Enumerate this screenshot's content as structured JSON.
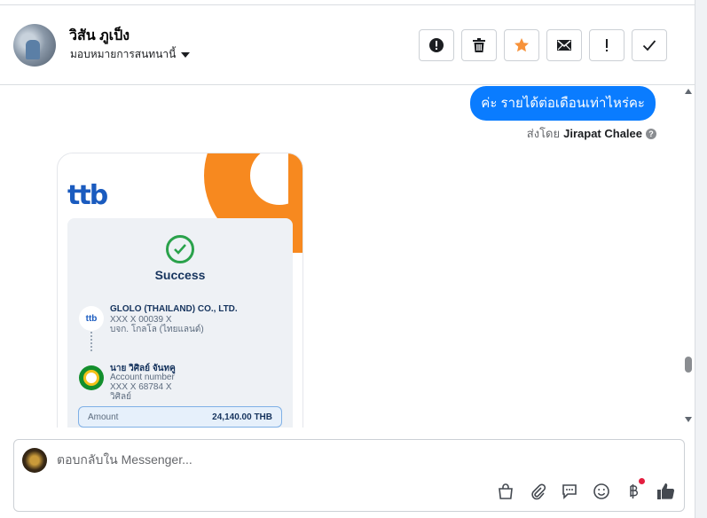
{
  "header": {
    "contact_name": "วิสัน ภูเป็ง",
    "assign_label": "มอบหมายการสนทนานี้"
  },
  "actions": [
    {
      "name": "report-spam",
      "icon": "alert-circle-icon"
    },
    {
      "name": "delete",
      "icon": "trash-icon"
    },
    {
      "name": "star",
      "icon": "star-icon",
      "color": "#f7923a"
    },
    {
      "name": "mark-unread",
      "icon": "envelope-icon"
    },
    {
      "name": "follow-up",
      "icon": "exclamation-icon"
    },
    {
      "name": "mark-done",
      "icon": "checkmark-icon"
    }
  ],
  "messages": {
    "outgoing_text": "ค่ะ รายได้ต่อเดือนเท่าไหร่คะ",
    "sent_by_prefix": "ส่งโดย",
    "sent_by_name": "Jirapat Chalee",
    "bubble_color": "#0a7cff"
  },
  "slip": {
    "logo_part1": "tt",
    "logo_part2": "b",
    "status": "Success",
    "sender": {
      "name": "GLOLO (THAILAND) CO., LTD.",
      "account": "XXX X 00039 X",
      "name_th": "บจก. โกลโล (ไทยแลนด์)",
      "bank_badge": "ttb"
    },
    "receiver": {
      "name": "นาย วิศิลย์ จันทคู",
      "account_label": "Account number",
      "account": "XXX X 68784 X",
      "short_name": "วิศิลย์"
    },
    "amount_label": "Amount",
    "amount_value": "24,140.00 THB"
  },
  "composer": {
    "placeholder": "ตอบกลับใน Messenger...",
    "tools": [
      "shopping-bag-icon",
      "paperclip-icon",
      "saved-reply-icon",
      "emoji-icon",
      "baht-icon",
      "thumbs-up-icon"
    ]
  }
}
